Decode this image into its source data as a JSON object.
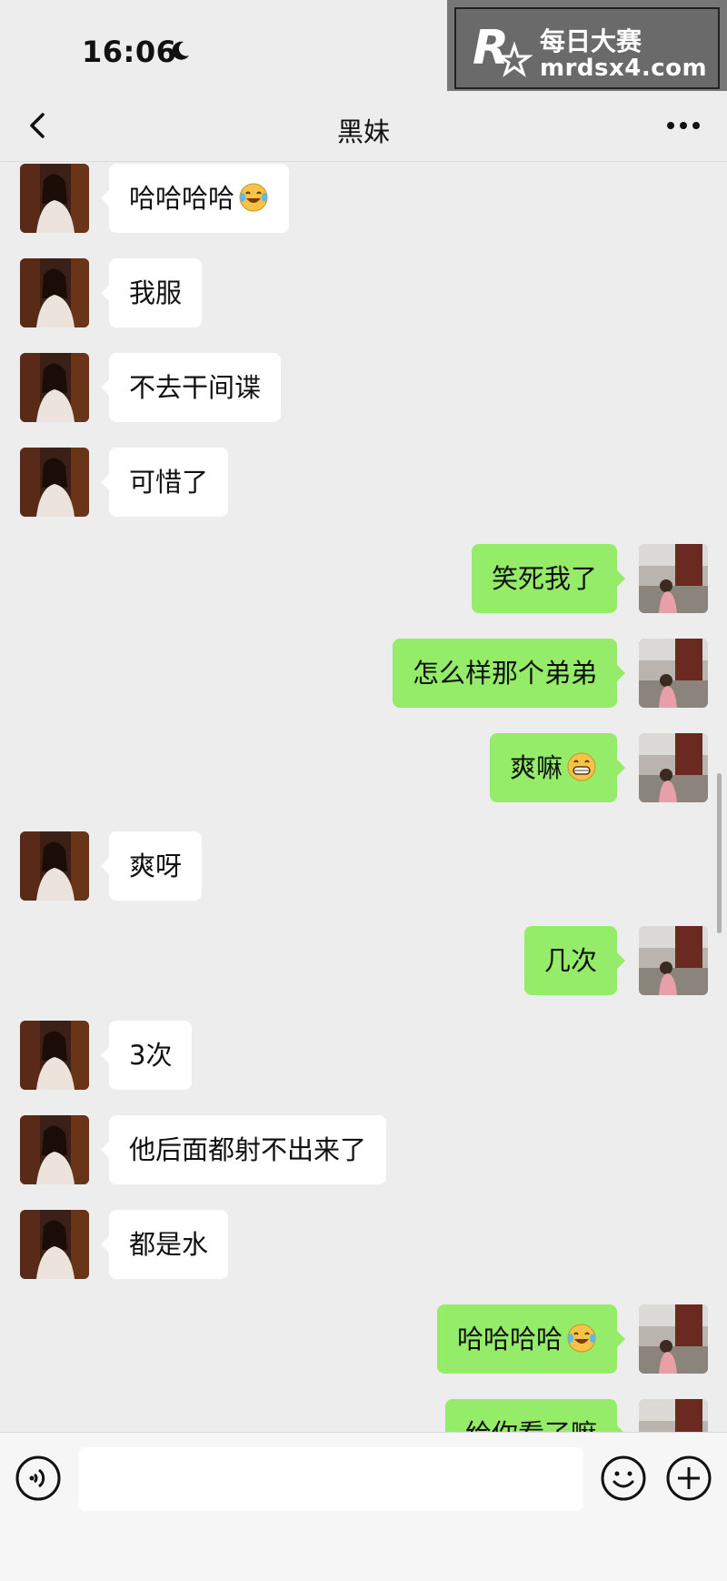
{
  "status_bar": {
    "time": "16:06",
    "moon_icon": "moon-icon"
  },
  "watermark": {
    "line1": "每日大赛",
    "line2": "mrdsx4.com",
    "logo_icon": "r-star-logo"
  },
  "nav": {
    "title": "黑妹",
    "back_icon": "chevron-left-icon",
    "more_icon": "more-dots-icon"
  },
  "messages": [
    {
      "side": "in",
      "text": "哈哈哈哈",
      "emoji": "tears-of-joy"
    },
    {
      "side": "in",
      "text": "我服"
    },
    {
      "side": "in",
      "text": "不去干间谍"
    },
    {
      "side": "in",
      "text": "可惜了"
    },
    {
      "side": "out",
      "text": "笑死我了"
    },
    {
      "side": "out",
      "text": "怎么样那个弟弟"
    },
    {
      "side": "out",
      "text": "爽嘛",
      "emoji": "grin"
    },
    {
      "side": "in",
      "text": "爽呀"
    },
    {
      "side": "out",
      "text": "几次"
    },
    {
      "side": "in",
      "text": "3次"
    },
    {
      "side": "in",
      "text": "他后面都射不出来了"
    },
    {
      "side": "in",
      "text": "都是水"
    },
    {
      "side": "out",
      "text": "哈哈哈哈",
      "emoji": "tears-of-joy"
    },
    {
      "side": "out",
      "text": "给你看了嘛"
    }
  ],
  "input_bar": {
    "voice_icon": "voice-icon",
    "emoji_icon": "smiley-icon",
    "plus_icon": "plus-circle-icon",
    "input_value": ""
  },
  "colors": {
    "background": "#ededed",
    "bubble_in": "#ffffff",
    "bubble_out": "#95ec69"
  }
}
